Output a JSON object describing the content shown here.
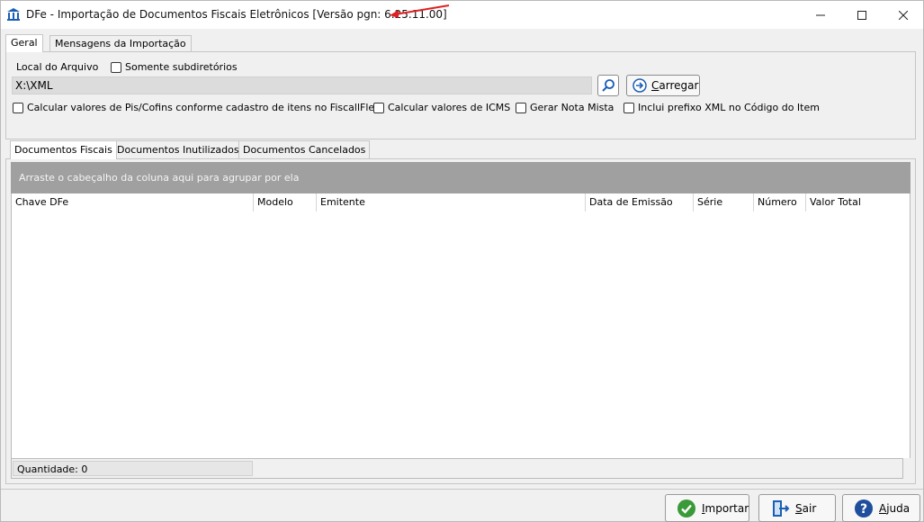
{
  "window": {
    "title": "DFe - Importação de Documentos Fiscais Eletrônicos [Versão pgn: 6.25.11.00]"
  },
  "top_tabs": [
    {
      "label": "Geral"
    },
    {
      "label": "Mensagens da Importação"
    }
  ],
  "file_section": {
    "label": "Local do Arquivo",
    "only_subdirs_label": "Somente subdiretórios",
    "path_value": "X:\\XML",
    "load_label_first": "C",
    "load_label_rest": "arregar"
  },
  "options": [
    {
      "label": "Calcular valores de Pis/Cofins conforme cadastro de itens  no FiscallFlex"
    },
    {
      "label": "Calcular valores de ICMS"
    },
    {
      "label": "Gerar Nota Mista"
    },
    {
      "label": "Inclui prefixo XML no Código do Item"
    }
  ],
  "inner_tabs": [
    {
      "label": "Documentos Fiscais"
    },
    {
      "label": "Documentos Inutilizados"
    },
    {
      "label": "Documentos Cancelados"
    }
  ],
  "grid": {
    "group_hint": "Arraste o cabeçalho da coluna aqui para agrupar por ela",
    "columns": [
      "Chave DFe",
      "Modelo",
      "Emitente",
      "Data de Emissão",
      "Série",
      "Número",
      "Valor Total"
    ],
    "quantity_text": "Quantidade: 0"
  },
  "buttons": {
    "import_first": "I",
    "import_rest": "mportar",
    "exit_first": "S",
    "exit_rest": "air",
    "help_first": "A",
    "help_rest": "juda"
  },
  "colors": {
    "accent_blue": "#1a5fb4",
    "import_green": "#3a9a3a",
    "help_blue": "#1f4e9c",
    "arrow_red": "#e02020",
    "group_bar": "#a0a0a0"
  }
}
